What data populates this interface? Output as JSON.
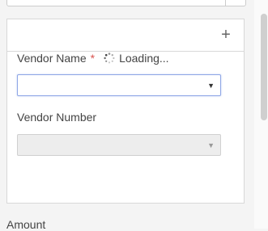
{
  "vendor_name": {
    "label": "Vendor Name",
    "required_marker": "*",
    "status": "Loading..."
  },
  "vendor_number": {
    "label": "Vendor Number"
  },
  "amount": {
    "label": "Amount"
  },
  "card": {
    "add_symbol": "+"
  },
  "icons": {
    "select_caret": "▼",
    "loading": "spinner-icon"
  },
  "colors": {
    "required": "#d9534f",
    "focus_border": "#8ea6e6"
  }
}
